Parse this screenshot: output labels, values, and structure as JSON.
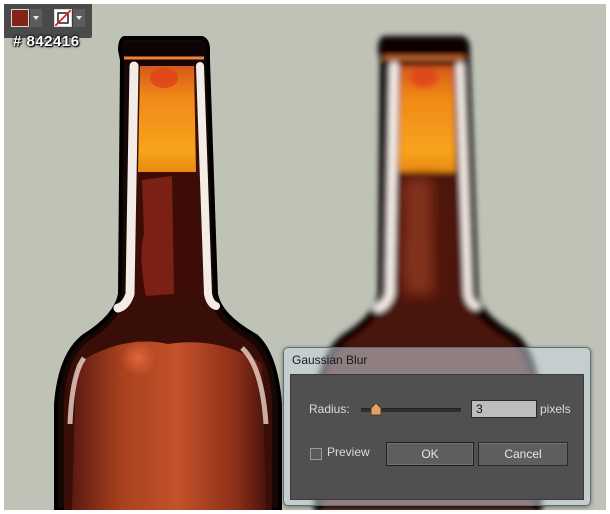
{
  "swatches": {
    "fill_color": "#842416",
    "stroke_color": "none",
    "hex_label": "# 842416"
  },
  "icons": {
    "fill_dropdown": "chevron-down-icon",
    "stroke_dropdown": "chevron-down-icon",
    "stroke_none": "no-color-slash-icon",
    "slider_thumb": "slider-thumb-icon"
  },
  "dialog": {
    "title": "Gaussian Blur",
    "radius_label": "Radius:",
    "radius_value": "3",
    "radius_unit": "pixels",
    "preview_label": "Preview",
    "preview_checked": false,
    "ok_label": "OK",
    "cancel_label": "Cancel"
  },
  "colors": {
    "canvas_bg": "#bfc3b6",
    "bottle_glass": "#842416",
    "liquid_top": "#f5a020",
    "dialog_panel": "#505050"
  }
}
